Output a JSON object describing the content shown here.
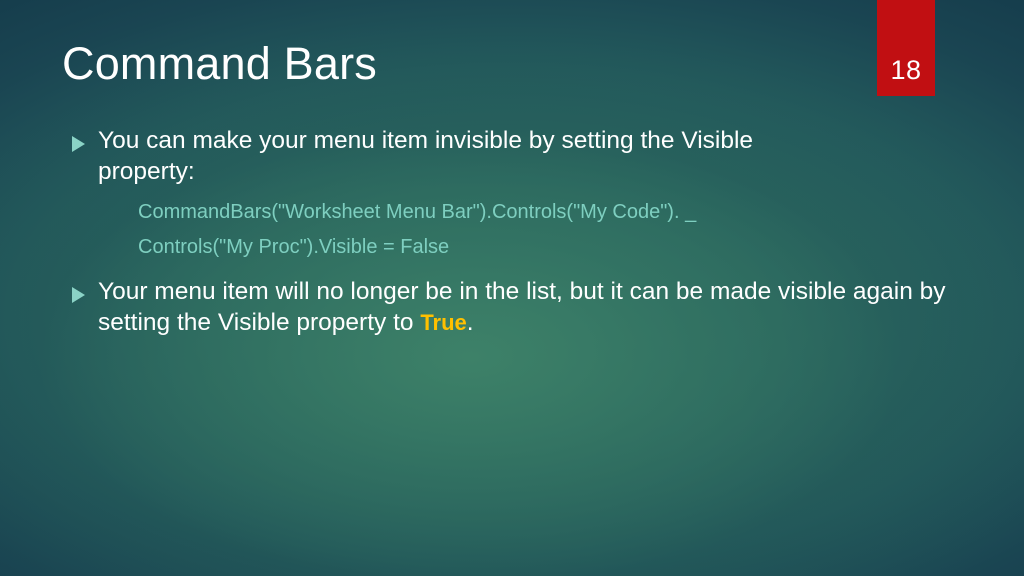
{
  "slide": {
    "title": "Command Bars",
    "page_number": "18",
    "badge_color": "#C10F12",
    "bullet_marker_color": "#8AD3C6",
    "code_color": "#7ECFC0",
    "highlight_color": "#FFC000",
    "text_color": "#FFFFFF",
    "bullet_marker_icon": "triangle-right-icon"
  },
  "body": {
    "bullets": [
      {
        "text": "You can make your menu item invisible by setting the Visible",
        "text_line2": "property:"
      },
      {
        "text_part1": "Your menu item will no longer be in the list, but it can be made visible again by setting the Visible property to ",
        "highlight": "True",
        "text_part2": "."
      }
    ],
    "code_lines": [
      "CommandBars(\"Worksheet Menu Bar\").Controls(\"My Code\"). _",
      "Controls(\"My Proc\").Visible = False"
    ]
  }
}
